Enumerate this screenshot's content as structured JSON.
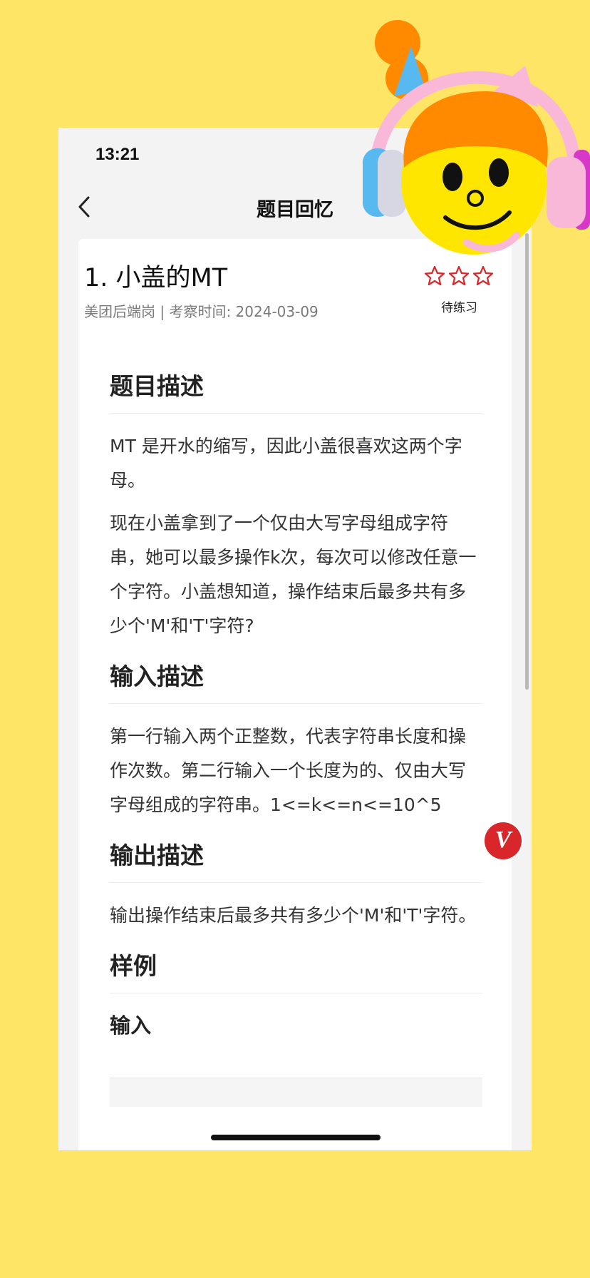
{
  "status_bar": {
    "time": "13:21"
  },
  "nav": {
    "title": "题目回忆",
    "back_icon": "chevron-left-icon"
  },
  "question": {
    "title": "1. 小盖的MT",
    "meta": "美团后端岗 | 考察时间: 2024-03-09",
    "rating_max": 3,
    "rating_filled": 0,
    "status": "待练习"
  },
  "sections": {
    "description_heading": "题目描述",
    "description_p1": "MT 是开水的缩写，因此小盖很喜欢这两个字母。",
    "description_p2": "现在小盖拿到了一个仅由大写字母组成字符串，她可以最多操作k次，每次可以修改任意一个字符。小盖想知道，操作结束后最多共有多少个'M'和'T'字符?",
    "input_heading": "输入描述",
    "input_p": "第一行输入两个正整数，代表字符串长度和操作次数。第二行输入一个长度为的、仅由大写字母组成的字符串。1<=k<=n<=10^5",
    "output_heading": "输出描述",
    "output_p": "输出操作结束后最多共有多少个'M'和'T'字符。",
    "sample_heading": "样例",
    "sample_input_label": "输入"
  },
  "badge": {
    "letter": "V",
    "color": "#D8262A"
  },
  "colors": {
    "background": "#FFE566",
    "star_outline": "#D8262A"
  }
}
